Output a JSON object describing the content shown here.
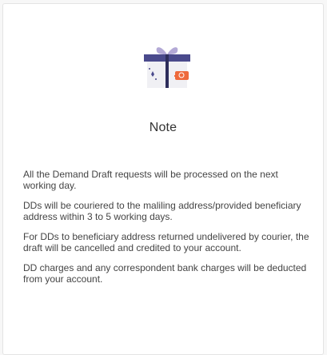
{
  "dialog": {
    "icon": "gift-icon",
    "title": "Note",
    "notes": [
      "All the Demand Draft requests will be processed on the next working day.",
      "DDs will be couriered to the maliling address/provided beneficiary address within 3 to 5 working days.",
      "For DDs to beneficiary address returned undelivered by courier, the draft will be cancelled and credited to your account.",
      "DD charges and any correspondent bank charges will be deducted from your account."
    ]
  },
  "colors": {
    "lid": "#4a4a8c",
    "ribbon": "#b3a9d6",
    "box": "#f0f0f4",
    "tag": "#ee6a3c"
  }
}
